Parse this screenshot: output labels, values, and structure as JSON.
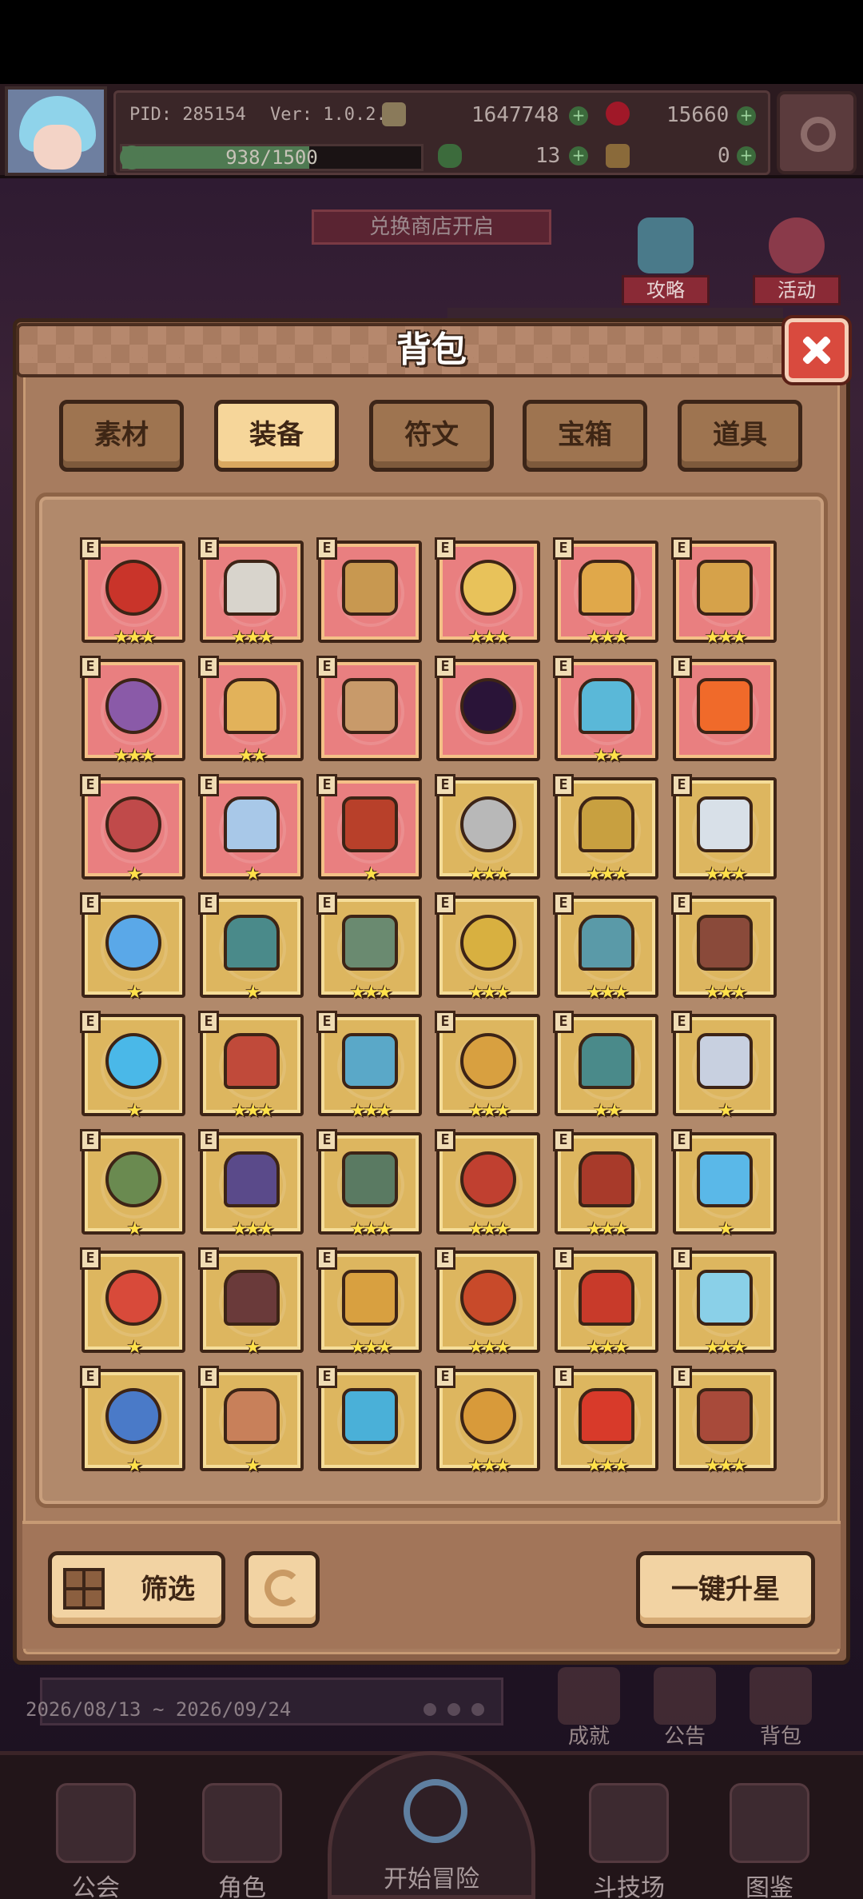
{
  "hud": {
    "pid": "PID: 285154",
    "version": "Ver: 1.0.2.4",
    "gold": "1647748",
    "gems": "15660",
    "clover": "13",
    "keys": "0",
    "energy": "938/1500",
    "energy_fraction": 0.625
  },
  "scene": {
    "exchange_banner": "兑换商店开启",
    "side_buttons": [
      "攻略",
      "活动"
    ],
    "event_date": "2026/08/13 ~ 2026/09/24",
    "mini_buttons": [
      "成就",
      "公告",
      "背包"
    ]
  },
  "nav": {
    "guild": "公会",
    "character": "角色",
    "adventure": "开始冒险",
    "arena": "斗技场",
    "codex": "图鉴"
  },
  "modal": {
    "title": "背包",
    "tabs": [
      "素材",
      "装备",
      "符文",
      "宝箱",
      "道具"
    ],
    "active_tab": "装备",
    "filter_label": "筛选",
    "upstar_label": "一键升星"
  },
  "item_tag": "E",
  "items": [
    {
      "name": "red-crossed-blades-icon",
      "rarity": "red",
      "stars": 3,
      "color": "#c9342a"
    },
    {
      "name": "battle-axe-icon",
      "rarity": "red",
      "stars": 3,
      "color": "#d8d4cc"
    },
    {
      "name": "wooden-staff-icon",
      "rarity": "red",
      "stars": 0,
      "color": "#c89850"
    },
    {
      "name": "straw-hat-icon",
      "rarity": "red",
      "stars": 3,
      "color": "#e8c25a"
    },
    {
      "name": "golden-horned-helm-icon",
      "rarity": "red",
      "stars": 3,
      "color": "#e0a84a"
    },
    {
      "name": "heart-pendant-icon",
      "rarity": "red",
      "stars": 3,
      "color": "#d6a24a"
    },
    {
      "name": "purple-amulet-icon",
      "rarity": "red",
      "stars": 3,
      "color": "#8a5aa8"
    },
    {
      "name": "gold-ring-icon",
      "rarity": "red",
      "stars": 2,
      "color": "#e2b25a"
    },
    {
      "name": "crystal-shard-icon",
      "rarity": "red",
      "stars": 0,
      "color": "#c89a6a"
    },
    {
      "name": "dark-orb-icon",
      "rarity": "red",
      "stars": 0,
      "color": "#2a1438"
    },
    {
      "name": "blue-gem-armor-icon",
      "rarity": "red",
      "stars": 2,
      "color": "#5ab8d8"
    },
    {
      "name": "flame-ring-icon",
      "rarity": "red",
      "stars": 0,
      "color": "#f06a2a"
    },
    {
      "name": "red-cloak-icon",
      "rarity": "red",
      "stars": 1,
      "color": "#c04a4a"
    },
    {
      "name": "ribbon-necklace-icon",
      "rarity": "red",
      "stars": 1,
      "color": "#a8c8e8"
    },
    {
      "name": "red-helmet-icon",
      "rarity": "red",
      "stars": 1,
      "color": "#b8402a"
    },
    {
      "name": "silver-axe-icon",
      "rarity": "gold",
      "stars": 3,
      "color": "#b8b8b8"
    },
    {
      "name": "golden-mace-icon",
      "rarity": "gold",
      "stars": 3,
      "color": "#c8a040"
    },
    {
      "name": "silver-wand-icon",
      "rarity": "gold",
      "stars": 3,
      "color": "#d8e0e8"
    },
    {
      "name": "blue-orb-wand-icon",
      "rarity": "gold",
      "stars": 1,
      "color": "#5aa8e8"
    },
    {
      "name": "teal-mace-icon",
      "rarity": "gold",
      "stars": 1,
      "color": "#4a8a8a"
    },
    {
      "name": "green-stone-orb-icon",
      "rarity": "gold",
      "stars": 3,
      "color": "#6a8a70"
    },
    {
      "name": "golden-shield-icon",
      "rarity": "gold",
      "stars": 3,
      "color": "#d8b040"
    },
    {
      "name": "magic-lamp-icon",
      "rarity": "gold",
      "stars": 3,
      "color": "#5a9aa8"
    },
    {
      "name": "wooden-shield-icon",
      "rarity": "gold",
      "stars": 3,
      "color": "#8a4a3a"
    },
    {
      "name": "blue-orb-icon",
      "rarity": "gold",
      "stars": 1,
      "color": "#4ab8e8"
    },
    {
      "name": "ruby-crown-icon",
      "rarity": "gold",
      "stars": 3,
      "color": "#c04a3a"
    },
    {
      "name": "sapphire-crown-icon",
      "rarity": "gold",
      "stars": 3,
      "color": "#5aa8c8"
    },
    {
      "name": "gold-circlet-icon",
      "rarity": "gold",
      "stars": 3,
      "color": "#d8a040"
    },
    {
      "name": "teal-helmet-icon",
      "rarity": "gold",
      "stars": 2,
      "color": "#4a8a8a"
    },
    {
      "name": "silver-crown-icon",
      "rarity": "gold",
      "stars": 1,
      "color": "#c8d0e0"
    },
    {
      "name": "jade-crown-icon",
      "rarity": "gold",
      "stars": 1,
      "color": "#6a8a50"
    },
    {
      "name": "winged-helm-icon",
      "rarity": "gold",
      "stars": 3,
      "color": "#5a4a8a"
    },
    {
      "name": "green-robe-icon",
      "rarity": "gold",
      "stars": 3,
      "color": "#5a7a62"
    },
    {
      "name": "red-gold-robe-icon",
      "rarity": "gold",
      "stars": 3,
      "color": "#c04030"
    },
    {
      "name": "red-armor-icon",
      "rarity": "gold",
      "stars": 3,
      "color": "#a83a2a"
    },
    {
      "name": "ice-armor-icon",
      "rarity": "gold",
      "stars": 1,
      "color": "#5ab8e8"
    },
    {
      "name": "red-gold-gauntlet-icon",
      "rarity": "gold",
      "stars": 1,
      "color": "#d84a3a"
    },
    {
      "name": "dark-gauntlet-icon",
      "rarity": "gold",
      "stars": 1,
      "color": "#6a3a3a"
    },
    {
      "name": "golden-bracer-icon",
      "rarity": "gold",
      "stars": 3,
      "color": "#d8a040"
    },
    {
      "name": "red-bracer-icon",
      "rarity": "gold",
      "stars": 3,
      "color": "#c84a2a"
    },
    {
      "name": "red-boot-icon",
      "rarity": "gold",
      "stars": 3,
      "color": "#c83a2a"
    },
    {
      "name": "ice-bracer-icon",
      "rarity": "gold",
      "stars": 3,
      "color": "#8ad0e8"
    },
    {
      "name": "blue-scroll-bracer-icon",
      "rarity": "gold",
      "stars": 1,
      "color": "#4a7ac8"
    },
    {
      "name": "leather-bracer-icon",
      "rarity": "gold",
      "stars": 1,
      "color": "#c8805a"
    },
    {
      "name": "ice-boot-icon",
      "rarity": "gold",
      "stars": 0,
      "color": "#4ab0d8"
    },
    {
      "name": "jeweled-ring-icon",
      "rarity": "gold",
      "stars": 3,
      "color": "#d89a3a"
    },
    {
      "name": "red-ring-icon",
      "rarity": "gold",
      "stars": 3,
      "color": "#d83a2a"
    },
    {
      "name": "gem-belt-icon",
      "rarity": "gold",
      "stars": 3,
      "color": "#a84a3a"
    }
  ]
}
